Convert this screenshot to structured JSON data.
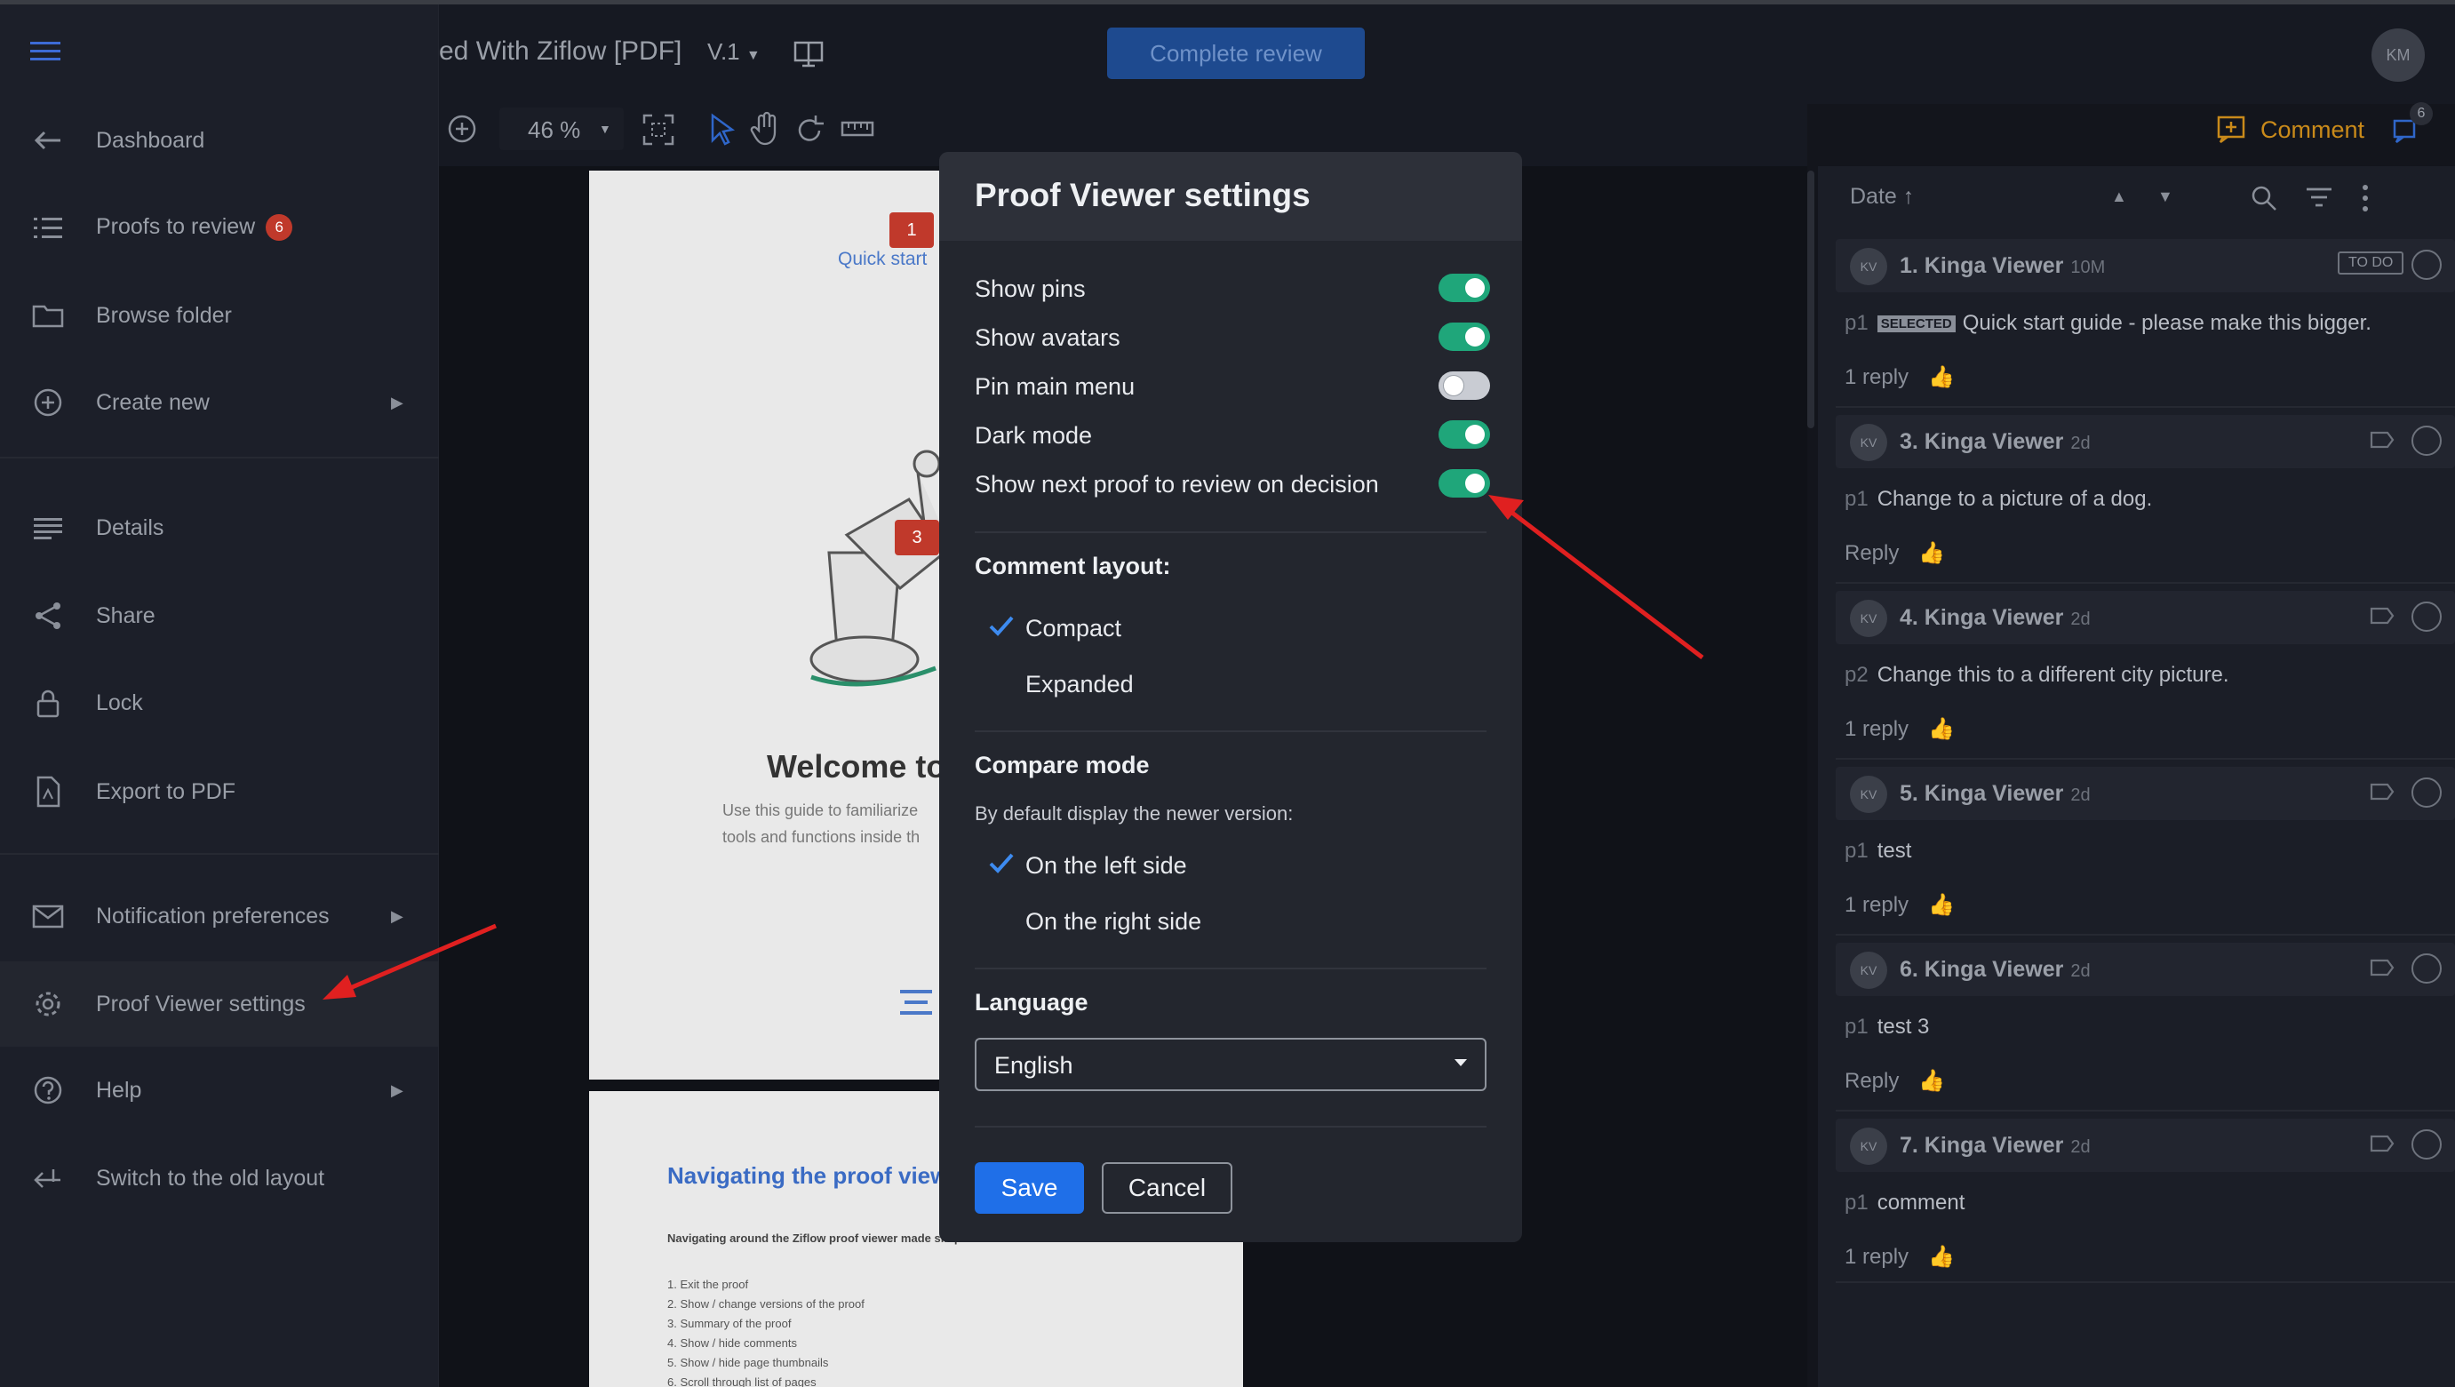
{
  "header": {
    "doc_title": "ed With Ziflow [PDF]",
    "version": "V.1",
    "complete_review": "Complete review",
    "user_initials": "KM",
    "zoom": "46 %",
    "comment_button": "Comment",
    "comment_count": "6"
  },
  "sidebar": {
    "items": [
      {
        "label": "Dashboard"
      },
      {
        "label": "Proofs to review",
        "badge": "6"
      },
      {
        "label": "Browse folder"
      },
      {
        "label": "Create new"
      },
      {
        "label": "Details"
      },
      {
        "label": "Share"
      },
      {
        "label": "Lock"
      },
      {
        "label": "Export to PDF"
      },
      {
        "label": "Notification preferences"
      },
      {
        "label": "Proof Viewer settings"
      },
      {
        "label": "Help"
      },
      {
        "label": "Switch to the old layout"
      }
    ]
  },
  "document": {
    "pin1": "1",
    "pin3": "3",
    "quick_start": "Quick start",
    "welcome": "Welcome to",
    "intro_line1": "Use this guide to familiarize",
    "intro_line2": "tools and functions inside th",
    "nav_title": "Navigating the proof view",
    "nav_sub": "Navigating around the Ziflow proof viewer made simple:",
    "nav_list": [
      "1.  Exit the proof",
      "2.  Show / change versions of the proof",
      "3.  Summary of the proof",
      "4.  Show / hide comments",
      "5.  Show / hide page thumbnails",
      "6.  Scroll through list of pages"
    ]
  },
  "comments": {
    "sort_label": "Date",
    "items": [
      {
        "avatar": "KV",
        "name": "1. Kinga Viewer",
        "time": "10M",
        "status": "TO DO",
        "page": "p1",
        "tag": "SELECTED",
        "text": "Quick start guide - please make this bigger.",
        "reply": "1 reply"
      },
      {
        "avatar": "KV",
        "name": "3. Kinga Viewer",
        "time": "2d",
        "page": "p1",
        "text": "Change to a picture of a dog.",
        "reply": "Reply"
      },
      {
        "avatar": "KV",
        "name": "4. Kinga Viewer",
        "time": "2d",
        "page": "p2",
        "text": "Change this to a different city picture.",
        "reply": "1 reply"
      },
      {
        "avatar": "KV",
        "name": "5. Kinga Viewer",
        "time": "2d",
        "page": "p1",
        "text": "test",
        "reply": "1 reply"
      },
      {
        "avatar": "KV",
        "name": "6. Kinga Viewer",
        "time": "2d",
        "page": "p1",
        "text": "test 3",
        "reply": "Reply"
      },
      {
        "avatar": "KV",
        "name": "7. Kinga Viewer",
        "time": "2d",
        "page": "p1",
        "text": "comment",
        "reply": "1 reply"
      }
    ]
  },
  "dialog": {
    "title": "Proof Viewer settings",
    "toggles": [
      {
        "label": "Show pins",
        "on": true
      },
      {
        "label": "Show avatars",
        "on": true
      },
      {
        "label": "Pin main menu",
        "on": false
      },
      {
        "label": "Dark mode",
        "on": true
      },
      {
        "label": "Show next proof to review on decision",
        "on": true
      }
    ],
    "comment_layout": {
      "title": "Comment layout:",
      "options": [
        "Compact",
        "Expanded"
      ],
      "selected": "Compact"
    },
    "compare_mode": {
      "title": "Compare mode",
      "subtitle": "By default display the newer version:",
      "options": [
        "On the left side",
        "On the right side"
      ],
      "selected": "On the left side"
    },
    "language": {
      "title": "Language",
      "value": "English"
    },
    "save": "Save",
    "cancel": "Cancel"
  },
  "colors": {
    "accent_green": "#1fa67a",
    "primary_blue": "#1f6fe8",
    "annotation_red": "#e02020",
    "badge_red": "#c0392b"
  }
}
